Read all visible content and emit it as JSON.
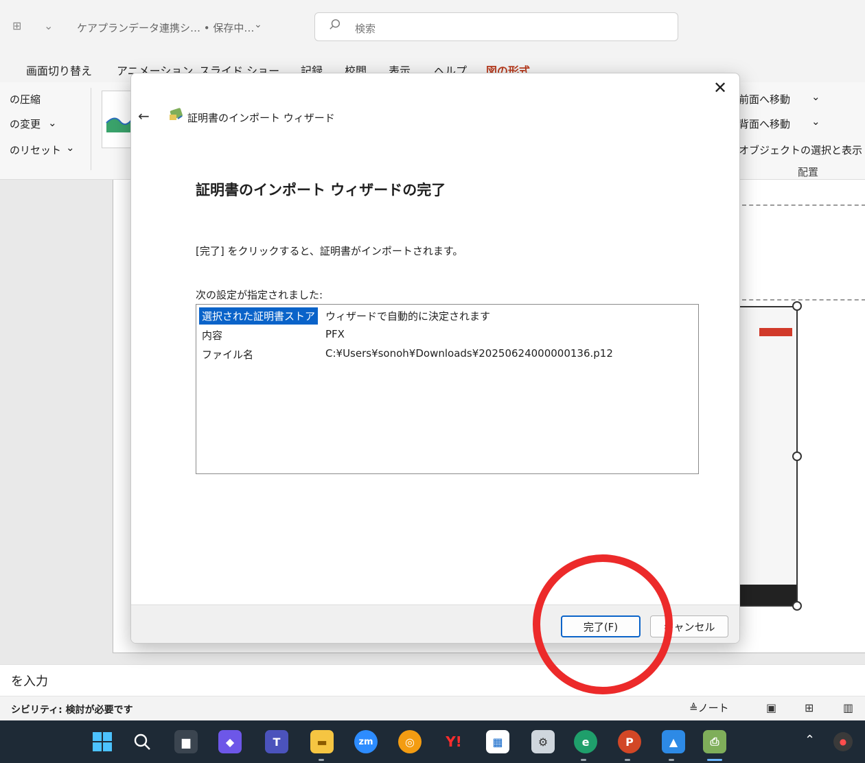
{
  "app": {
    "doc_title": "ケアプランデータ連携シ… • 保存中…",
    "search_placeholder": "検索",
    "ribbon_tabs": [
      "画面切り替え",
      "アニメーション",
      "スライド ショー",
      "記録",
      "校閲",
      "表示",
      "ヘルプ",
      "図の形式"
    ],
    "active_tab": "図の形式",
    "ribbon_left": {
      "compress": "の圧縮",
      "change": "の変更",
      "reset": "のリセット"
    },
    "ribbon_right": {
      "bring_forward": "前面へ移動",
      "send_backward": "背面へ移動",
      "selection_pane": "オブジェクトの選択と表示",
      "arrange_group": "配置"
    },
    "notes_placeholder": "を入力",
    "accessibility_status": "シビリティ: 検討が必要です",
    "notes_button": "ノート"
  },
  "dialog": {
    "wizard_title": "証明書のインポート ウィザード",
    "heading": "証明書のインポート ウィザードの完了",
    "instruction": "[完了] をクリックすると、証明書がインポートされます。",
    "settings_label": "次の設定が指定されました:",
    "settings": [
      {
        "key": "選択された証明書ストア",
        "value": "ウィザードで自動的に決定されます"
      },
      {
        "key": "内容",
        "value": "PFX"
      },
      {
        "key": "ファイル名",
        "value": "C:¥Users¥sonoh¥Downloads¥20250624000000136.p12"
      }
    ],
    "finish_label": "完了(F)",
    "cancel_label": "キャンセル",
    "close_glyph": "✕",
    "back_glyph": "←"
  },
  "colors": {
    "accent": "#0a63c9",
    "annotation": "#ec2a2a",
    "active_tab": "#b83b1e"
  }
}
